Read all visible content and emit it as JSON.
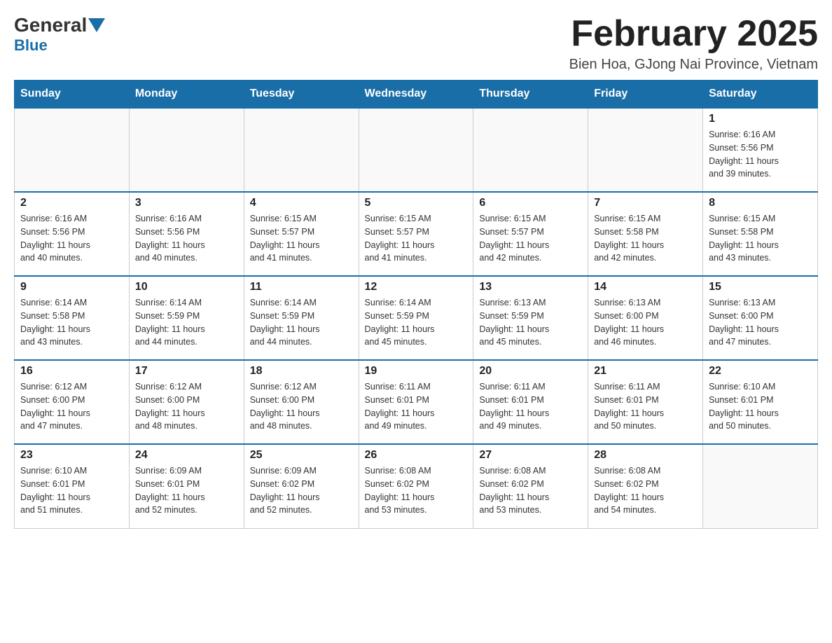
{
  "header": {
    "logo": {
      "general": "General",
      "blue": "Blue"
    },
    "title": "February 2025",
    "location": "Bien Hoa, GJong Nai Province, Vietnam"
  },
  "days_of_week": [
    "Sunday",
    "Monday",
    "Tuesday",
    "Wednesday",
    "Thursday",
    "Friday",
    "Saturday"
  ],
  "weeks": [
    [
      {
        "day": "",
        "info": ""
      },
      {
        "day": "",
        "info": ""
      },
      {
        "day": "",
        "info": ""
      },
      {
        "day": "",
        "info": ""
      },
      {
        "day": "",
        "info": ""
      },
      {
        "day": "",
        "info": ""
      },
      {
        "day": "1",
        "info": "Sunrise: 6:16 AM\nSunset: 5:56 PM\nDaylight: 11 hours\nand 39 minutes."
      }
    ],
    [
      {
        "day": "2",
        "info": "Sunrise: 6:16 AM\nSunset: 5:56 PM\nDaylight: 11 hours\nand 40 minutes."
      },
      {
        "day": "3",
        "info": "Sunrise: 6:16 AM\nSunset: 5:56 PM\nDaylight: 11 hours\nand 40 minutes."
      },
      {
        "day": "4",
        "info": "Sunrise: 6:15 AM\nSunset: 5:57 PM\nDaylight: 11 hours\nand 41 minutes."
      },
      {
        "day": "5",
        "info": "Sunrise: 6:15 AM\nSunset: 5:57 PM\nDaylight: 11 hours\nand 41 minutes."
      },
      {
        "day": "6",
        "info": "Sunrise: 6:15 AM\nSunset: 5:57 PM\nDaylight: 11 hours\nand 42 minutes."
      },
      {
        "day": "7",
        "info": "Sunrise: 6:15 AM\nSunset: 5:58 PM\nDaylight: 11 hours\nand 42 minutes."
      },
      {
        "day": "8",
        "info": "Sunrise: 6:15 AM\nSunset: 5:58 PM\nDaylight: 11 hours\nand 43 minutes."
      }
    ],
    [
      {
        "day": "9",
        "info": "Sunrise: 6:14 AM\nSunset: 5:58 PM\nDaylight: 11 hours\nand 43 minutes."
      },
      {
        "day": "10",
        "info": "Sunrise: 6:14 AM\nSunset: 5:59 PM\nDaylight: 11 hours\nand 44 minutes."
      },
      {
        "day": "11",
        "info": "Sunrise: 6:14 AM\nSunset: 5:59 PM\nDaylight: 11 hours\nand 44 minutes."
      },
      {
        "day": "12",
        "info": "Sunrise: 6:14 AM\nSunset: 5:59 PM\nDaylight: 11 hours\nand 45 minutes."
      },
      {
        "day": "13",
        "info": "Sunrise: 6:13 AM\nSunset: 5:59 PM\nDaylight: 11 hours\nand 45 minutes."
      },
      {
        "day": "14",
        "info": "Sunrise: 6:13 AM\nSunset: 6:00 PM\nDaylight: 11 hours\nand 46 minutes."
      },
      {
        "day": "15",
        "info": "Sunrise: 6:13 AM\nSunset: 6:00 PM\nDaylight: 11 hours\nand 47 minutes."
      }
    ],
    [
      {
        "day": "16",
        "info": "Sunrise: 6:12 AM\nSunset: 6:00 PM\nDaylight: 11 hours\nand 47 minutes."
      },
      {
        "day": "17",
        "info": "Sunrise: 6:12 AM\nSunset: 6:00 PM\nDaylight: 11 hours\nand 48 minutes."
      },
      {
        "day": "18",
        "info": "Sunrise: 6:12 AM\nSunset: 6:00 PM\nDaylight: 11 hours\nand 48 minutes."
      },
      {
        "day": "19",
        "info": "Sunrise: 6:11 AM\nSunset: 6:01 PM\nDaylight: 11 hours\nand 49 minutes."
      },
      {
        "day": "20",
        "info": "Sunrise: 6:11 AM\nSunset: 6:01 PM\nDaylight: 11 hours\nand 49 minutes."
      },
      {
        "day": "21",
        "info": "Sunrise: 6:11 AM\nSunset: 6:01 PM\nDaylight: 11 hours\nand 50 minutes."
      },
      {
        "day": "22",
        "info": "Sunrise: 6:10 AM\nSunset: 6:01 PM\nDaylight: 11 hours\nand 50 minutes."
      }
    ],
    [
      {
        "day": "23",
        "info": "Sunrise: 6:10 AM\nSunset: 6:01 PM\nDaylight: 11 hours\nand 51 minutes."
      },
      {
        "day": "24",
        "info": "Sunrise: 6:09 AM\nSunset: 6:01 PM\nDaylight: 11 hours\nand 52 minutes."
      },
      {
        "day": "25",
        "info": "Sunrise: 6:09 AM\nSunset: 6:02 PM\nDaylight: 11 hours\nand 52 minutes."
      },
      {
        "day": "26",
        "info": "Sunrise: 6:08 AM\nSunset: 6:02 PM\nDaylight: 11 hours\nand 53 minutes."
      },
      {
        "day": "27",
        "info": "Sunrise: 6:08 AM\nSunset: 6:02 PM\nDaylight: 11 hours\nand 53 minutes."
      },
      {
        "day": "28",
        "info": "Sunrise: 6:08 AM\nSunset: 6:02 PM\nDaylight: 11 hours\nand 54 minutes."
      },
      {
        "day": "",
        "info": ""
      }
    ]
  ]
}
